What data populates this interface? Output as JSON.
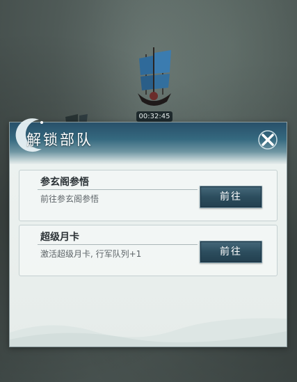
{
  "scene": {
    "timer": "00:32:45"
  },
  "dialog": {
    "title": "解锁部队",
    "close_icon": "close-x-icon",
    "cards": [
      {
        "title": "参玄阁参悟",
        "description": "前往参玄阁参悟",
        "button_label": "前往"
      },
      {
        "title": "超级月卡",
        "description": "激活超级月卡, 行军队列+1",
        "button_label": "前往"
      }
    ]
  },
  "colors": {
    "header_dark": "#28506a",
    "button_dark": "#2c4d5e",
    "panel_bg": "#eef3f1"
  }
}
